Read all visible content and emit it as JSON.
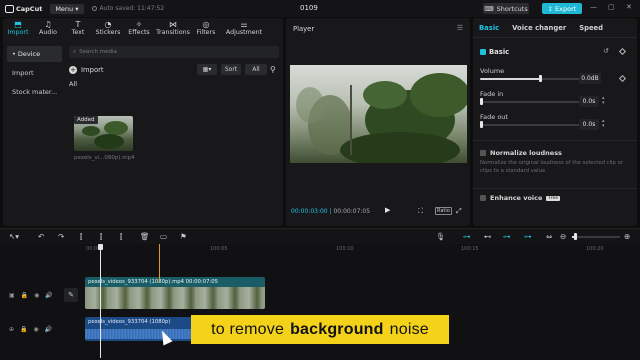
{
  "topbar": {
    "logo": "CapCut",
    "menu": "Menu",
    "saved": "Auto saved: 11:47:52",
    "project": "0109",
    "shortcuts": "Shortcuts",
    "export": "Export"
  },
  "tools": [
    {
      "label": "Import",
      "icon": "import-icon"
    },
    {
      "label": "Audio",
      "icon": "audio-icon"
    },
    {
      "label": "Text",
      "icon": "text-icon"
    },
    {
      "label": "Stickers",
      "icon": "stickers-icon"
    },
    {
      "label": "Effects",
      "icon": "effects-icon"
    },
    {
      "label": "Transitions",
      "icon": "transitions-icon"
    },
    {
      "label": "Filters",
      "icon": "filters-icon"
    },
    {
      "label": "Adjustment",
      "icon": "adjustment-icon"
    }
  ],
  "sidebar": {
    "items": [
      "• Device",
      "Import",
      "Stock mater..."
    ]
  },
  "media": {
    "search_placeholder": "Search media",
    "import": "Import",
    "sort": "Sort",
    "all_filter": "All",
    "all_label": "All",
    "added_badge": "Added",
    "thumb_name": "pexels_vi...080p).mp4"
  },
  "player": {
    "title": "Player",
    "current": "00:00:03:00",
    "total": "00:00:07:05",
    "ratio": "Ratio"
  },
  "right": {
    "tabs": [
      "Basic",
      "Voice changer",
      "Speed"
    ],
    "basic": "Basic",
    "volume_label": "Volume",
    "volume_value": "0.0dB",
    "volume_level": 0.6,
    "fade_in_label": "Fade in",
    "fade_in_value": "0.0s",
    "fade_out_label": "Fade out",
    "fade_out_value": "0.0s",
    "normalize_label": "Normalize loudness",
    "normalize_desc": "Normalize the original loudness of the selected clip or clips to a standard value",
    "enhance_label": "Enhance voice",
    "enhance_badge": "Free"
  },
  "timeline": {
    "ticks": [
      "00:00",
      "100:05",
      "100:10",
      "100:15",
      "100:20"
    ],
    "video_clip": "pexels_videos_933704 (1080p).mp4   00:00:07:05",
    "audio_clip": "pexels_videos_933704 (1080p)"
  },
  "caption": {
    "before": "to remove",
    "bold": "background",
    "after": "noise"
  },
  "colors": {
    "accent": "#1fc3e0",
    "caption_bg": "#f5d21a",
    "video_clip": "#1a5d66",
    "audio_clip": "#1b4a86"
  }
}
